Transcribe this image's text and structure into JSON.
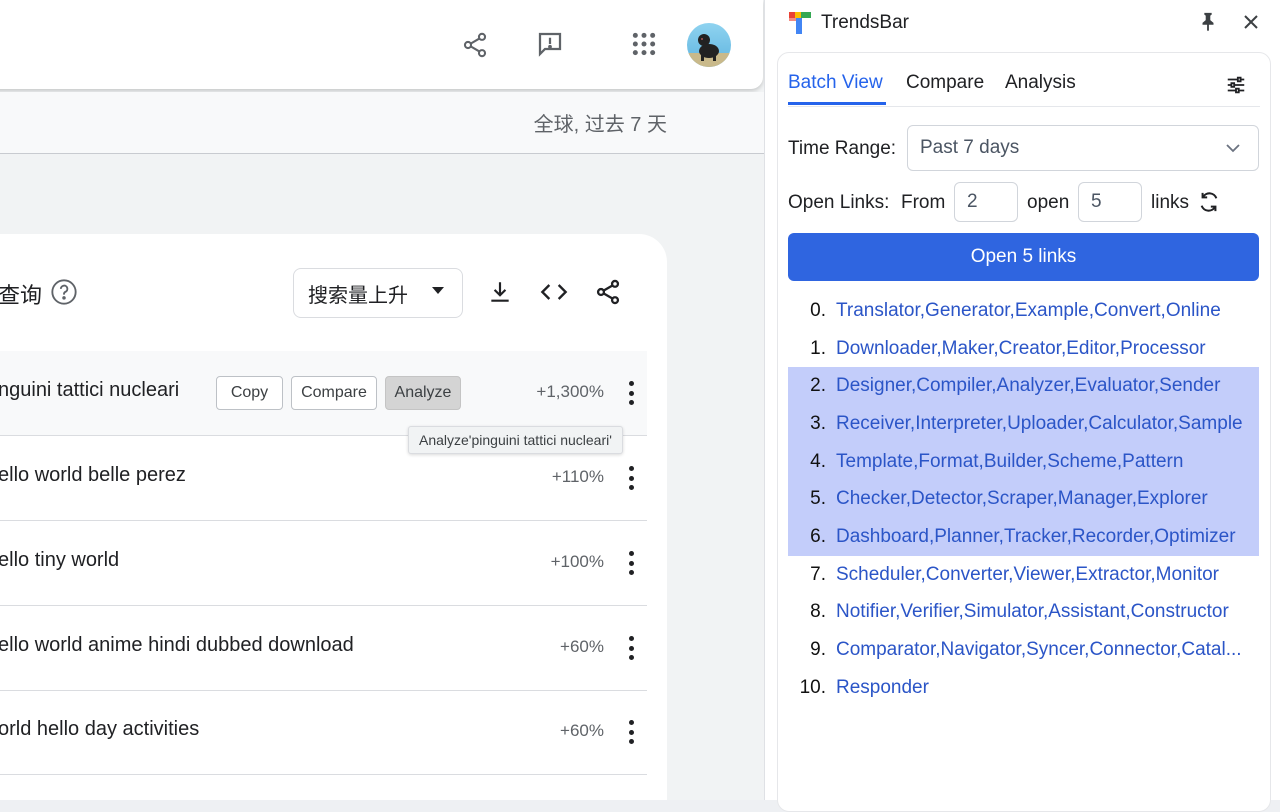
{
  "trends": {
    "region_label": "全球, 过去 7 天",
    "card_title": "查询",
    "sort_label": "搜索量上升",
    "rows": [
      {
        "text": "nguini tattici nucleari",
        "pct": "+1,300%"
      },
      {
        "text": "ello world belle perez",
        "pct": "+110%"
      },
      {
        "text": "ello tiny world",
        "pct": "+100%"
      },
      {
        "text": "ello world anime hindi dubbed download",
        "pct": "+60%"
      },
      {
        "text": "orld hello day activities",
        "pct": "+60%"
      }
    ],
    "row_buttons": {
      "copy": "Copy",
      "compare": "Compare",
      "analyze": "Analyze"
    },
    "tooltip": "Analyze'pinguini tattici nucleari'"
  },
  "panel": {
    "app_name": "TrendsBar",
    "tabs": [
      {
        "label": "Batch View",
        "active": true
      },
      {
        "label": "Compare",
        "active": false
      },
      {
        "label": "Analysis",
        "active": false
      }
    ],
    "time_range_label": "Time Range:",
    "time_range_value": "Past 7 days",
    "open_links_label": "Open Links:",
    "from_label": "From",
    "from_value": "2",
    "open_label": "open",
    "count_value": "5",
    "links_label": "links",
    "open_button": "Open 5 links",
    "items": [
      {
        "num": "0.",
        "text": "Translator,Generator,Example,Convert,Online",
        "selected": false
      },
      {
        "num": "1.",
        "text": "Downloader,Maker,Creator,Editor,Processor",
        "selected": false
      },
      {
        "num": "2.",
        "text": "Designer,Compiler,Analyzer,Evaluator,Sender",
        "selected": true
      },
      {
        "num": "3.",
        "text": "Receiver,Interpreter,Uploader,Calculator,Sample",
        "selected": true
      },
      {
        "num": "4.",
        "text": "Template,Format,Builder,Scheme,Pattern",
        "selected": true
      },
      {
        "num": "5.",
        "text": "Checker,Detector,Scraper,Manager,Explorer",
        "selected": true
      },
      {
        "num": "6.",
        "text": "Dashboard,Planner,Tracker,Recorder,Optimizer",
        "selected": true
      },
      {
        "num": "7.",
        "text": "Scheduler,Converter,Viewer,Extractor,Monitor",
        "selected": false
      },
      {
        "num": "8.",
        "text": "Notifier,Verifier,Simulator,Assistant,Constructor",
        "selected": false
      },
      {
        "num": "9.",
        "text": "Comparator,Navigator,Syncer,Connector,Catal...",
        "selected": false
      },
      {
        "num": "10.",
        "text": "Responder",
        "selected": false
      }
    ]
  },
  "colors": {
    "accent": "#2563eb",
    "selected_bg": "#c3cdfa",
    "link": "#2b55c7"
  }
}
